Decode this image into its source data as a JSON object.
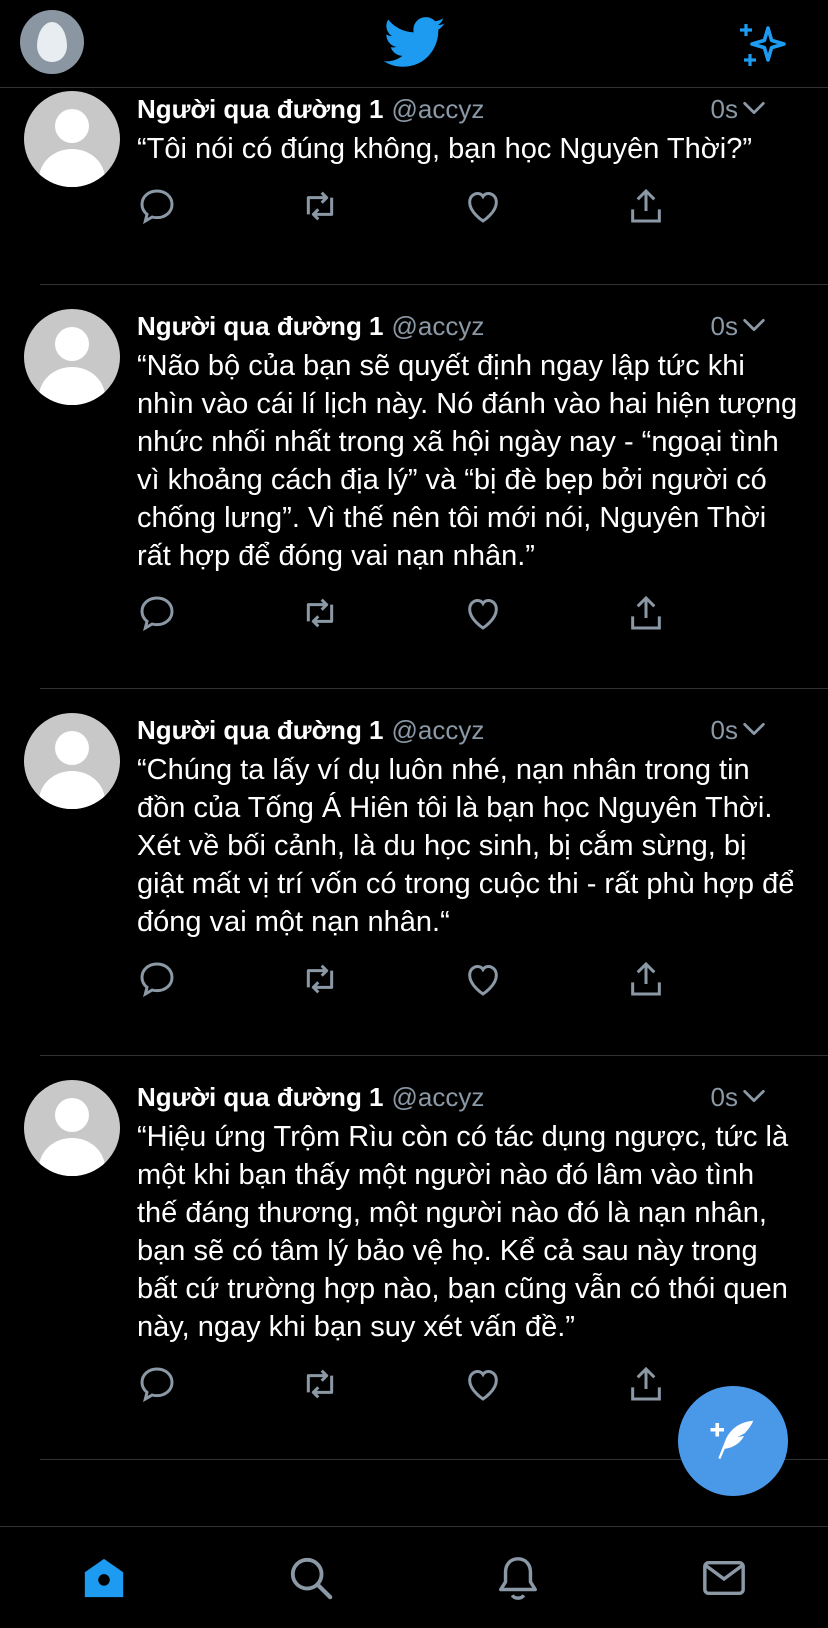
{
  "app": {
    "name": "Twitter",
    "accent": "#1d9bf0",
    "fab_color": "#4a99e9"
  },
  "topbar": {
    "left": "profile-avatar",
    "center": "twitter-bird-icon",
    "right": "sparkle-icon"
  },
  "tweets": [
    {
      "author": "Người qua đường 1",
      "handle": "@accyz",
      "time": "0s",
      "text": "“Tôi nói có đúng không, bạn học Nguyên Thời?”"
    },
    {
      "author": "Người qua đường 1",
      "handle": "@accyz",
      "time": "0s",
      "text": "“Não bộ của bạn sẽ quyết định ngay lập tức khi nhìn vào cái lí lịch này. Nó đánh vào hai hiện tượng nhức nhối nhất trong xã hội ngày nay - “ngoại tình vì khoảng cách địa lý” và “bị đè bẹp bởi người có chống lưng”. Vì thế nên tôi mới nói, Nguyên Thời rất hợp để đóng vai nạn nhân.”"
    },
    {
      "author": "Người qua đường 1",
      "handle": "@accyz",
      "time": "0s",
      "text": "“Chúng ta lấy ví dụ luôn nhé, nạn nhân trong tin đồn của Tống Á Hiên tôi là bạn học Nguyên Thời. Xét về bối cảnh, là du học sinh, bị cắm sừng, bị giật mất vị trí vốn có trong cuộc thi - rất phù hợp để đóng vai một nạn nhân.“"
    },
    {
      "author": "Người qua đường 1",
      "handle": "@accyz",
      "time": "0s",
      "text": "“Hiệu ứng Trộm Rìu còn có tác dụng ngược, tức là một khi bạn thấy một người nào đó lâm vào tình thế đáng thương, một người nào đó là nạn nhân, bạn sẽ có tâm lý bảo vệ họ. Kể cả sau này trong bất cứ trường hợp nào, bạn cũng vẫn có thói quen này, ngay khi bạn suy xét vấn đề.”"
    }
  ],
  "actions": [
    "reply-icon",
    "retweet-icon",
    "like-icon",
    "share-icon"
  ],
  "bottom_tabs": [
    "home-icon",
    "search-icon",
    "notifications-icon",
    "messages-icon"
  ],
  "active_tab": "home-icon"
}
